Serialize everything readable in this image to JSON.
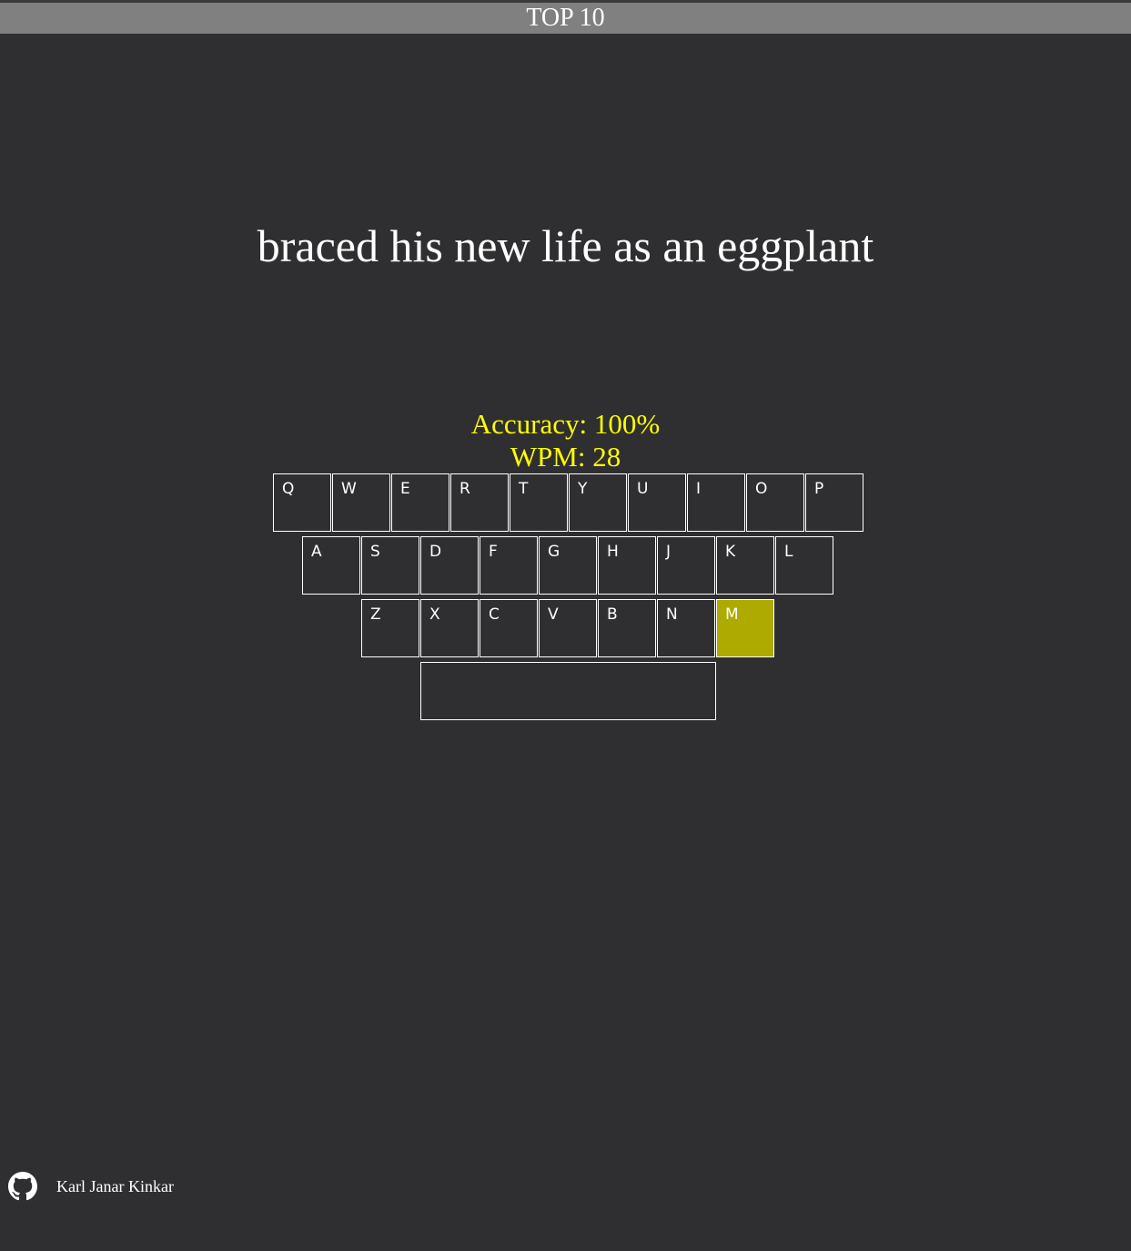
{
  "header": {
    "top10_label": "TOP 10"
  },
  "main": {
    "sentence": "braced his new life as an eggplant"
  },
  "stats": {
    "accuracy": "Accuracy: 100%",
    "wpm": "WPM: 28"
  },
  "keyboard": {
    "rows": [
      [
        "Q",
        "W",
        "E",
        "R",
        "T",
        "Y",
        "U",
        "I",
        "O",
        "P"
      ],
      [
        "A",
        "S",
        "D",
        "F",
        "G",
        "H",
        "J",
        "K",
        "L"
      ],
      [
        "Z",
        "X",
        "C",
        "V",
        "B",
        "N",
        "M"
      ]
    ],
    "active_key": "M",
    "colors": {
      "active": "#aeaa00",
      "border": "#ffffff"
    }
  },
  "footer": {
    "icon": "github-icon",
    "author": "Karl Janar Kinkar"
  },
  "colors": {
    "background": "#2f2f31",
    "top_bar": "#808080",
    "stats_text": "#ffff00",
    "text": "#ffffff"
  }
}
